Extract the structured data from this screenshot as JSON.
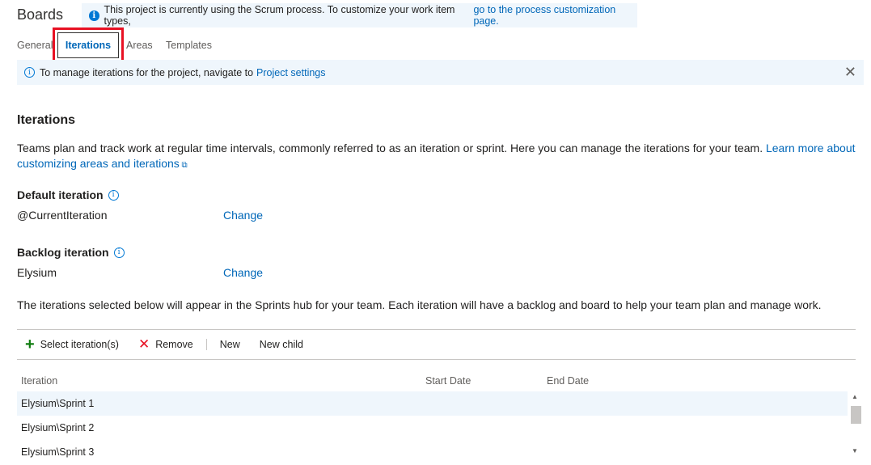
{
  "header": {
    "title": "Boards",
    "process_notice": "This project is currently using the Scrum process. To customize your work item types, ",
    "process_link": "go to the process customization page."
  },
  "tabs": [
    {
      "label": "General"
    },
    {
      "label": "Iterations"
    },
    {
      "label": "Areas"
    },
    {
      "label": "Templates"
    }
  ],
  "manage_banner": {
    "text": "To manage iterations for the project, navigate to ",
    "link": "Project settings"
  },
  "section": {
    "title": "Iterations",
    "description": "Teams plan and track work at regular time intervals, commonly referred to as an iteration or sprint. Here you can manage the iterations for your team. ",
    "learn_more_link": "Learn more about customizing areas and iterations"
  },
  "default_iteration": {
    "label": "Default iteration",
    "value": "@CurrentIteration",
    "change_label": "Change"
  },
  "backlog_iteration": {
    "label": "Backlog iteration",
    "value": "Elysium",
    "change_label": "Change"
  },
  "sprints_description": "The iterations selected below will appear in the Sprints hub for your team. Each iteration will have a backlog and board to help your team plan and manage work.",
  "toolbar": {
    "select_label": "Select iteration(s)",
    "remove_label": "Remove",
    "new_label": "New",
    "new_child_label": "New child"
  },
  "grid": {
    "columns": [
      "Iteration",
      "Start Date",
      "End Date"
    ],
    "rows": [
      {
        "iteration": "Elysium\\Sprint 1",
        "start": "",
        "end": ""
      },
      {
        "iteration": "Elysium\\Sprint 2",
        "start": "",
        "end": ""
      },
      {
        "iteration": "Elysium\\Sprint 3",
        "start": "",
        "end": ""
      }
    ]
  },
  "colors": {
    "accent": "#0078d4",
    "link": "#0067b8",
    "highlight_box": "#e81123",
    "banner_bg": "#eff6fc",
    "add_icon": "#107c10",
    "remove_icon": "#e81123"
  },
  "icons": {
    "info": "info-icon",
    "close": "close-icon",
    "add": "plus-icon",
    "remove": "x-icon",
    "external": "external-link-icon"
  }
}
